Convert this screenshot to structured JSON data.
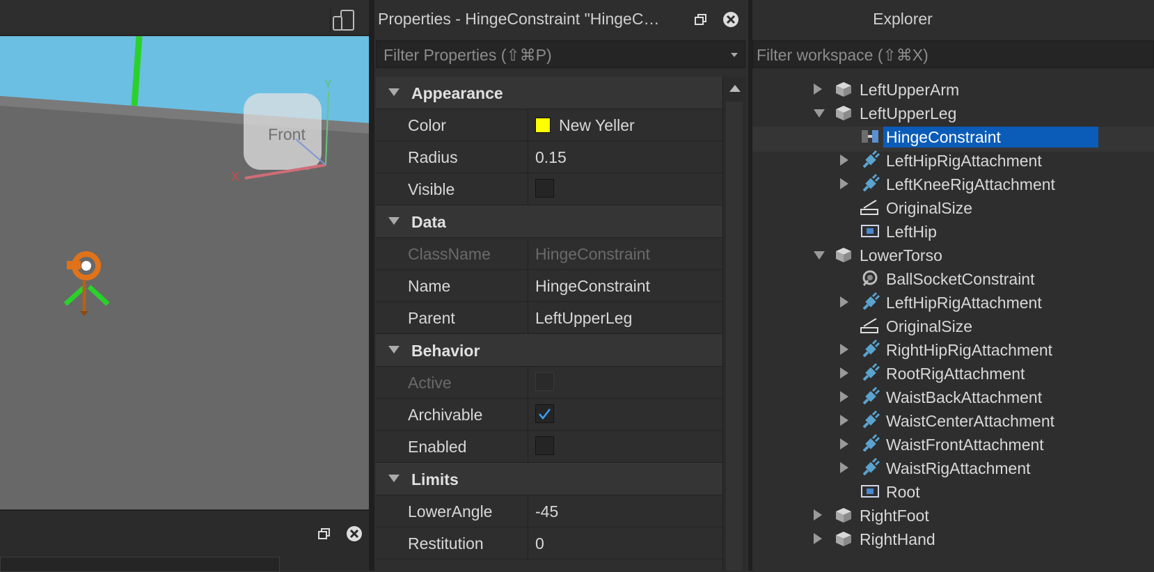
{
  "properties": {
    "title": "Properties - HingeConstraint \"HingeCo...",
    "filter_placeholder": "Filter Properties (⇧⌘P)",
    "categories": [
      {
        "label": "Appearance",
        "rows": [
          {
            "name": "Color",
            "value": "New Yeller",
            "swatch": "#ffff00"
          },
          {
            "name": "Radius",
            "value": "0.15"
          },
          {
            "name": "Visible",
            "checkbox": false
          }
        ]
      },
      {
        "label": "Data",
        "rows": [
          {
            "name": "ClassName",
            "value": "HingeConstraint",
            "disabled": true
          },
          {
            "name": "Name",
            "value": "HingeConstraint"
          },
          {
            "name": "Parent",
            "value": "LeftUpperLeg"
          }
        ]
      },
      {
        "label": "Behavior",
        "rows": [
          {
            "name": "Active",
            "checkbox": false,
            "disabled": true
          },
          {
            "name": "Archivable",
            "checkbox": true
          },
          {
            "name": "Enabled",
            "checkbox": false
          }
        ]
      },
      {
        "label": "Limits",
        "rows": [
          {
            "name": "LowerAngle",
            "value": "-45"
          },
          {
            "name": "Restitution",
            "value": "0"
          }
        ]
      }
    ]
  },
  "explorer": {
    "title": "Explorer",
    "filter_placeholder": "Filter workspace (⇧⌘X)",
    "tree": [
      {
        "label": "LeftUpperArm",
        "icon": "part-icon",
        "depth": 0,
        "expander": "closed"
      },
      {
        "label": "LeftUpperLeg",
        "icon": "part-icon",
        "depth": 0,
        "expander": "open"
      },
      {
        "label": "HingeConstraint",
        "icon": "hinge-constraint-icon",
        "depth": 1,
        "expander": "none",
        "selected": true
      },
      {
        "label": "LeftHipRigAttachment",
        "icon": "attachment-icon",
        "depth": 1,
        "expander": "closed"
      },
      {
        "label": "LeftKneeRigAttachment",
        "icon": "attachment-icon",
        "depth": 1,
        "expander": "closed"
      },
      {
        "label": "OriginalSize",
        "icon": "value-icon",
        "depth": 1,
        "expander": "none"
      },
      {
        "label": "LeftHip",
        "icon": "motor-icon",
        "depth": 1,
        "expander": "none"
      },
      {
        "label": "LowerTorso",
        "icon": "part-icon",
        "depth": 0,
        "expander": "open"
      },
      {
        "label": "BallSocketConstraint",
        "icon": "ball-socket-icon",
        "depth": 1,
        "expander": "none"
      },
      {
        "label": "LeftHipRigAttachment",
        "icon": "attachment-icon",
        "depth": 1,
        "expander": "closed"
      },
      {
        "label": "OriginalSize",
        "icon": "value-icon",
        "depth": 1,
        "expander": "none"
      },
      {
        "label": "RightHipRigAttachment",
        "icon": "attachment-icon",
        "depth": 1,
        "expander": "closed"
      },
      {
        "label": "RootRigAttachment",
        "icon": "attachment-icon",
        "depth": 1,
        "expander": "closed"
      },
      {
        "label": "WaistBackAttachment",
        "icon": "attachment-icon",
        "depth": 1,
        "expander": "closed"
      },
      {
        "label": "WaistCenterAttachment",
        "icon": "attachment-icon",
        "depth": 1,
        "expander": "closed"
      },
      {
        "label": "WaistFrontAttachment",
        "icon": "attachment-icon",
        "depth": 1,
        "expander": "closed"
      },
      {
        "label": "WaistRigAttachment",
        "icon": "attachment-icon",
        "depth": 1,
        "expander": "closed"
      },
      {
        "label": "Root",
        "icon": "motor-icon",
        "depth": 1,
        "expander": "none"
      },
      {
        "label": "RightFoot",
        "icon": "part-icon",
        "depth": 0,
        "expander": "closed"
      },
      {
        "label": "RightHand",
        "icon": "part-icon",
        "depth": 0,
        "expander": "closed"
      }
    ]
  },
  "viewport": {
    "view_cube_label": "Front",
    "axis_x_label": "X",
    "axis_y_label": "Y"
  },
  "colors": {
    "selection": "#0b5cb8",
    "swatch_new_yeller": "#ffff00",
    "checkbox_check": "#3aa0ff",
    "sky": "#6bbfe3",
    "baseplate": "#6b6b6b"
  }
}
